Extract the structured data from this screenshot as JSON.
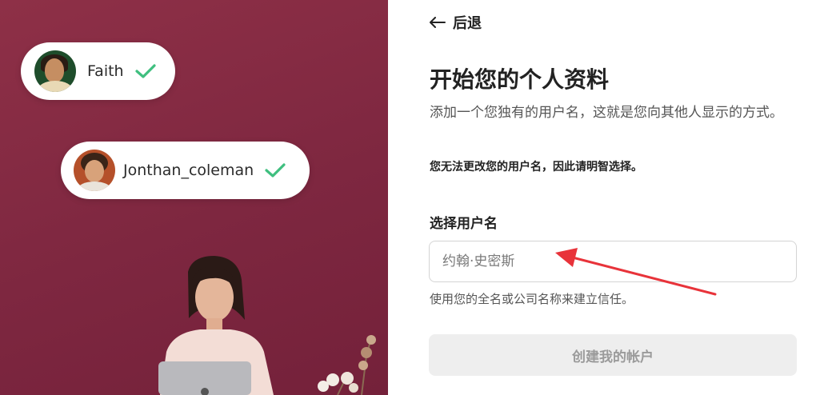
{
  "chips": [
    {
      "name": "Faith"
    },
    {
      "name": "Jonthan_coleman"
    }
  ],
  "back": {
    "label": "后退"
  },
  "form": {
    "title": "开始您的个人资料",
    "description": "添加一个您独有的用户名，这就是您向其他人显示的方式。",
    "warning": "您无法更改您的用户名，因此请明智选择。",
    "username_label": "选择用户名",
    "username_placeholder": "约翰·史密斯",
    "username_value": "",
    "hint": "使用您的全名或公司名称来建立信任。",
    "submit_label": "创建我的帐户"
  },
  "colors": {
    "panel_bg": "#822a43",
    "check_green": "#3fbf7f",
    "annotation_red": "#e8333a",
    "button_disabled_bg": "#eeeeee"
  },
  "icons": [
    "check-icon",
    "back-arrow-icon",
    "apple-logo-icon"
  ]
}
